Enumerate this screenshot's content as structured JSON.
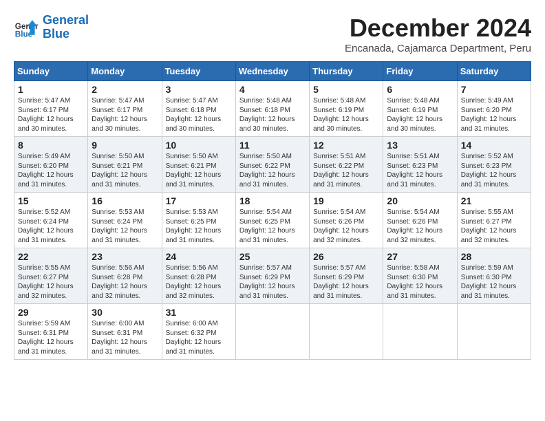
{
  "header": {
    "logo_line1": "General",
    "logo_line2": "Blue",
    "month": "December 2024",
    "location": "Encanada, Cajamarca Department, Peru"
  },
  "columns": [
    "Sunday",
    "Monday",
    "Tuesday",
    "Wednesday",
    "Thursday",
    "Friday",
    "Saturday"
  ],
  "weeks": [
    [
      {
        "day": "1",
        "info": "Sunrise: 5:47 AM\nSunset: 6:17 PM\nDaylight: 12 hours\nand 30 minutes."
      },
      {
        "day": "2",
        "info": "Sunrise: 5:47 AM\nSunset: 6:17 PM\nDaylight: 12 hours\nand 30 minutes."
      },
      {
        "day": "3",
        "info": "Sunrise: 5:47 AM\nSunset: 6:18 PM\nDaylight: 12 hours\nand 30 minutes."
      },
      {
        "day": "4",
        "info": "Sunrise: 5:48 AM\nSunset: 6:18 PM\nDaylight: 12 hours\nand 30 minutes."
      },
      {
        "day": "5",
        "info": "Sunrise: 5:48 AM\nSunset: 6:19 PM\nDaylight: 12 hours\nand 30 minutes."
      },
      {
        "day": "6",
        "info": "Sunrise: 5:48 AM\nSunset: 6:19 PM\nDaylight: 12 hours\nand 30 minutes."
      },
      {
        "day": "7",
        "info": "Sunrise: 5:49 AM\nSunset: 6:20 PM\nDaylight: 12 hours\nand 31 minutes."
      }
    ],
    [
      {
        "day": "8",
        "info": "Sunrise: 5:49 AM\nSunset: 6:20 PM\nDaylight: 12 hours\nand 31 minutes."
      },
      {
        "day": "9",
        "info": "Sunrise: 5:50 AM\nSunset: 6:21 PM\nDaylight: 12 hours\nand 31 minutes."
      },
      {
        "day": "10",
        "info": "Sunrise: 5:50 AM\nSunset: 6:21 PM\nDaylight: 12 hours\nand 31 minutes."
      },
      {
        "day": "11",
        "info": "Sunrise: 5:50 AM\nSunset: 6:22 PM\nDaylight: 12 hours\nand 31 minutes."
      },
      {
        "day": "12",
        "info": "Sunrise: 5:51 AM\nSunset: 6:22 PM\nDaylight: 12 hours\nand 31 minutes."
      },
      {
        "day": "13",
        "info": "Sunrise: 5:51 AM\nSunset: 6:23 PM\nDaylight: 12 hours\nand 31 minutes."
      },
      {
        "day": "14",
        "info": "Sunrise: 5:52 AM\nSunset: 6:23 PM\nDaylight: 12 hours\nand 31 minutes."
      }
    ],
    [
      {
        "day": "15",
        "info": "Sunrise: 5:52 AM\nSunset: 6:24 PM\nDaylight: 12 hours\nand 31 minutes."
      },
      {
        "day": "16",
        "info": "Sunrise: 5:53 AM\nSunset: 6:24 PM\nDaylight: 12 hours\nand 31 minutes."
      },
      {
        "day": "17",
        "info": "Sunrise: 5:53 AM\nSunset: 6:25 PM\nDaylight: 12 hours\nand 31 minutes."
      },
      {
        "day": "18",
        "info": "Sunrise: 5:54 AM\nSunset: 6:25 PM\nDaylight: 12 hours\nand 31 minutes."
      },
      {
        "day": "19",
        "info": "Sunrise: 5:54 AM\nSunset: 6:26 PM\nDaylight: 12 hours\nand 32 minutes."
      },
      {
        "day": "20",
        "info": "Sunrise: 5:54 AM\nSunset: 6:26 PM\nDaylight: 12 hours\nand 32 minutes."
      },
      {
        "day": "21",
        "info": "Sunrise: 5:55 AM\nSunset: 6:27 PM\nDaylight: 12 hours\nand 32 minutes."
      }
    ],
    [
      {
        "day": "22",
        "info": "Sunrise: 5:55 AM\nSunset: 6:27 PM\nDaylight: 12 hours\nand 32 minutes."
      },
      {
        "day": "23",
        "info": "Sunrise: 5:56 AM\nSunset: 6:28 PM\nDaylight: 12 hours\nand 32 minutes."
      },
      {
        "day": "24",
        "info": "Sunrise: 5:56 AM\nSunset: 6:28 PM\nDaylight: 12 hours\nand 32 minutes."
      },
      {
        "day": "25",
        "info": "Sunrise: 5:57 AM\nSunset: 6:29 PM\nDaylight: 12 hours\nand 31 minutes."
      },
      {
        "day": "26",
        "info": "Sunrise: 5:57 AM\nSunset: 6:29 PM\nDaylight: 12 hours\nand 31 minutes."
      },
      {
        "day": "27",
        "info": "Sunrise: 5:58 AM\nSunset: 6:30 PM\nDaylight: 12 hours\nand 31 minutes."
      },
      {
        "day": "28",
        "info": "Sunrise: 5:59 AM\nSunset: 6:30 PM\nDaylight: 12 hours\nand 31 minutes."
      }
    ],
    [
      {
        "day": "29",
        "info": "Sunrise: 5:59 AM\nSunset: 6:31 PM\nDaylight: 12 hours\nand 31 minutes."
      },
      {
        "day": "30",
        "info": "Sunrise: 6:00 AM\nSunset: 6:31 PM\nDaylight: 12 hours\nand 31 minutes."
      },
      {
        "day": "31",
        "info": "Sunrise: 6:00 AM\nSunset: 6:32 PM\nDaylight: 12 hours\nand 31 minutes."
      },
      {
        "day": "",
        "info": ""
      },
      {
        "day": "",
        "info": ""
      },
      {
        "day": "",
        "info": ""
      },
      {
        "day": "",
        "info": ""
      }
    ]
  ]
}
